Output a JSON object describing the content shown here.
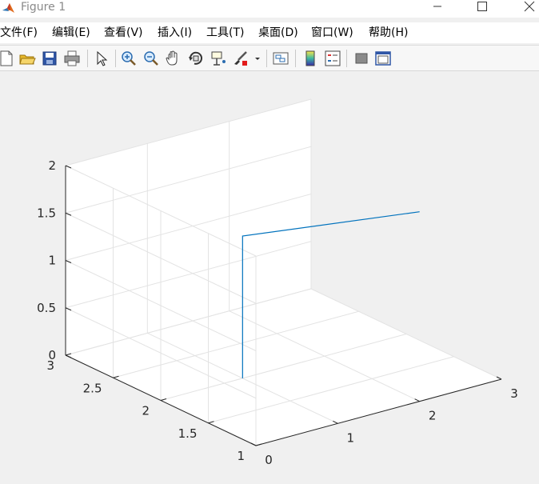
{
  "window": {
    "title": "Figure 1",
    "icon": "matlab-logo-icon",
    "controls": [
      "minimize-icon",
      "maximize-icon",
      "close-icon"
    ]
  },
  "menu": [
    {
      "label": "文件(F)"
    },
    {
      "label": "编辑(E)"
    },
    {
      "label": "查看(V)"
    },
    {
      "label": "插入(I)"
    },
    {
      "label": "工具(T)"
    },
    {
      "label": "桌面(D)"
    },
    {
      "label": "窗口(W)"
    },
    {
      "label": "帮助(H)"
    }
  ],
  "toolbar": {
    "buttons": [
      "new-figure-icon",
      "open-file-icon",
      "save-icon",
      "print-icon",
      "edit-plot-icon",
      "zoom-in-icon",
      "zoom-out-icon",
      "pan-icon",
      "rotate-3d-icon",
      "data-cursor-icon",
      "brush-icon",
      "brush-dropdown-icon",
      "link-plot-icon",
      "colorbar-icon",
      "legend-icon",
      "hide-plot-tools-icon",
      "show-plot-tools-icon"
    ]
  },
  "chart_data": {
    "type": "line",
    "projection": "3d",
    "grid": true,
    "xlim": [
      0,
      3
    ],
    "ylim": [
      1,
      3
    ],
    "zlim": [
      0,
      2
    ],
    "x_ticks": [
      "0",
      "1",
      "2",
      "3"
    ],
    "y_ticks": [
      "1",
      "1.5",
      "2",
      "2.5",
      "3"
    ],
    "z_ticks": [
      "0",
      "0.5",
      "1",
      "1.5",
      "2"
    ],
    "series": [
      {
        "color": "#0072bd",
        "points": [
          {
            "x": 1,
            "y": 2,
            "z": 0
          },
          {
            "x": 1,
            "y": 2,
            "z": 1.5
          },
          {
            "x": 2,
            "y": 1,
            "z": 2
          }
        ]
      }
    ]
  }
}
